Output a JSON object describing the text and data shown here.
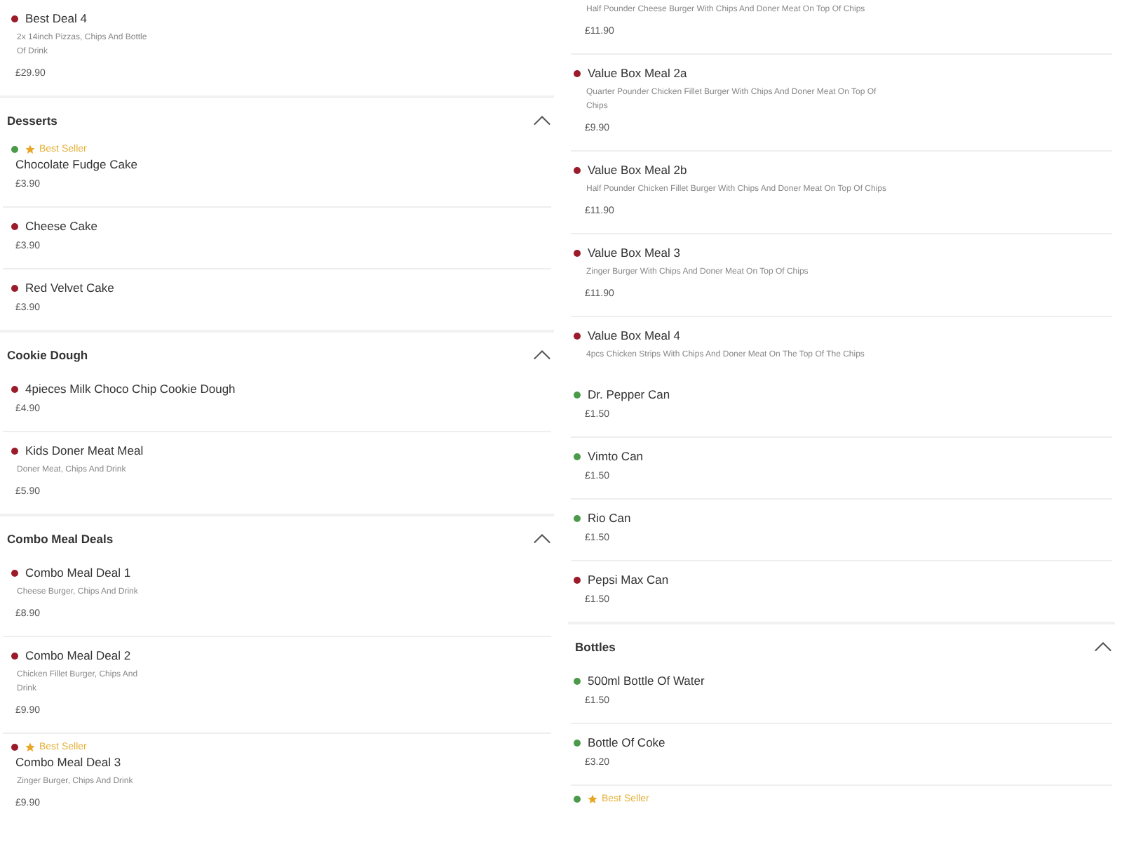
{
  "columns": [
    {
      "entries": [
        {
          "kind": "item",
          "veg": false,
          "best_seller": false,
          "name": "Best Deal 4",
          "description": "2x 14inch Pizzas, Chips And Bottle Of Drink",
          "price": "£29.90"
        },
        {
          "kind": "section",
          "title": "Desserts",
          "expanded": true
        },
        {
          "kind": "item",
          "veg": true,
          "best_seller": true,
          "badge": "Best Seller",
          "name": "Chocolate Fudge Cake",
          "price": "£3.90"
        },
        {
          "kind": "item",
          "veg": false,
          "best_seller": false,
          "name": "Cheese Cake",
          "price": "£3.90"
        },
        {
          "kind": "item",
          "veg": false,
          "best_seller": false,
          "name": "Red Velvet Cake",
          "price": "£3.90"
        },
        {
          "kind": "section",
          "title": "Cookie Dough",
          "expanded": true
        },
        {
          "kind": "item",
          "veg": false,
          "best_seller": false,
          "name": "4pieces Milk Choco Chip Cookie Dough",
          "price": "£4.90"
        },
        {
          "kind": "item",
          "veg": false,
          "best_seller": false,
          "name": "Kids Doner Meat Meal",
          "description": "Doner Meat, Chips And Drink",
          "price": "£5.90"
        },
        {
          "kind": "section",
          "title": "Combo Meal Deals",
          "expanded": true
        },
        {
          "kind": "item",
          "veg": false,
          "best_seller": false,
          "name": "Combo Meal Deal 1",
          "description": "Cheese Burger, Chips And Drink",
          "price": "£8.90"
        },
        {
          "kind": "item",
          "veg": false,
          "best_seller": false,
          "name": "Combo Meal Deal 2",
          "description": "Chicken Fillet Burger, Chips And Drink",
          "price": "£9.90"
        },
        {
          "kind": "item",
          "veg": false,
          "best_seller": true,
          "badge": "Best Seller",
          "name": "Combo Meal Deal 3",
          "description": "Zinger Burger, Chips And Drink",
          "price": "£9.90"
        }
      ]
    },
    {
      "entries": [
        {
          "kind": "item",
          "best_seller": false,
          "description": "Half Pounder Cheese Burger With Chips And Doner Meat On Top Of Chips",
          "price": "£11.90"
        },
        {
          "kind": "item",
          "veg": false,
          "best_seller": false,
          "name": "Value Box Meal 2a",
          "description": "Quarter Pounder Chicken Fillet Burger With Chips And Doner Meat On Top Of Chips",
          "price": "£9.90"
        },
        {
          "kind": "item",
          "veg": false,
          "best_seller": false,
          "name": "Value Box Meal 2b",
          "description": "Half Pounder Chicken Fillet Burger With Chips And Doner Meat On Top Of Chips",
          "price": "£11.90"
        },
        {
          "kind": "item",
          "veg": false,
          "best_seller": false,
          "name": "Value Box Meal 3",
          "description": "Zinger Burger With Chips And Doner Meat On Top Of Chips",
          "price": "£11.90"
        },
        {
          "kind": "item",
          "veg": false,
          "best_seller": false,
          "name": "Value Box Meal 4",
          "description": "4pcs Chicken Strips With Chips And Doner Meat On The Top Of The Chips"
        },
        {
          "kind": "item",
          "veg": true,
          "best_seller": false,
          "name": "Dr. Pepper Can",
          "price": "£1.50"
        },
        {
          "kind": "item",
          "veg": true,
          "best_seller": false,
          "name": "Vimto Can",
          "price": "£1.50"
        },
        {
          "kind": "item",
          "veg": true,
          "best_seller": false,
          "name": "Rio Can",
          "price": "£1.50"
        },
        {
          "kind": "item",
          "veg": false,
          "best_seller": false,
          "name": "Pepsi Max Can",
          "price": "£1.50"
        },
        {
          "kind": "section",
          "title": "Bottles",
          "expanded": true
        },
        {
          "kind": "item",
          "veg": true,
          "best_seller": false,
          "name": "500ml Bottle Of Water",
          "price": "£1.50"
        },
        {
          "kind": "item",
          "veg": true,
          "best_seller": false,
          "name": "Bottle Of Coke",
          "price": "£3.20"
        },
        {
          "kind": "item",
          "veg": true,
          "best_seller": true,
          "badge": "Best Seller"
        }
      ]
    }
  ]
}
